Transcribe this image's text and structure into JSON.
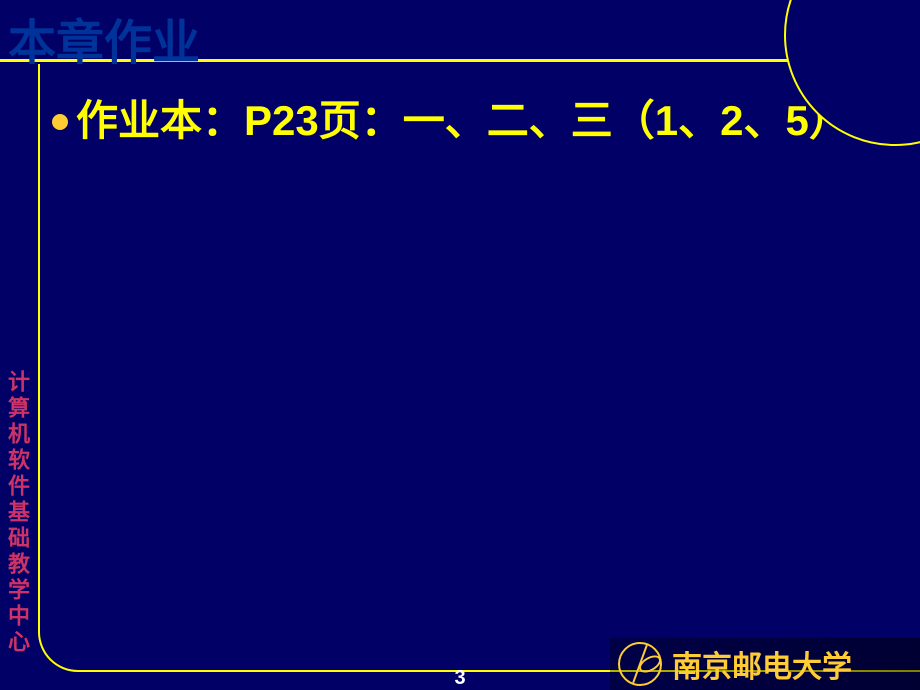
{
  "title": "本章作业",
  "content": {
    "bullet_text": "作业本：P23页：一、二、三（1、2、5）"
  },
  "sidebar": "计算机软件基础教学中心",
  "page_number": "3",
  "logo": {
    "university": "南京邮电大学"
  }
}
